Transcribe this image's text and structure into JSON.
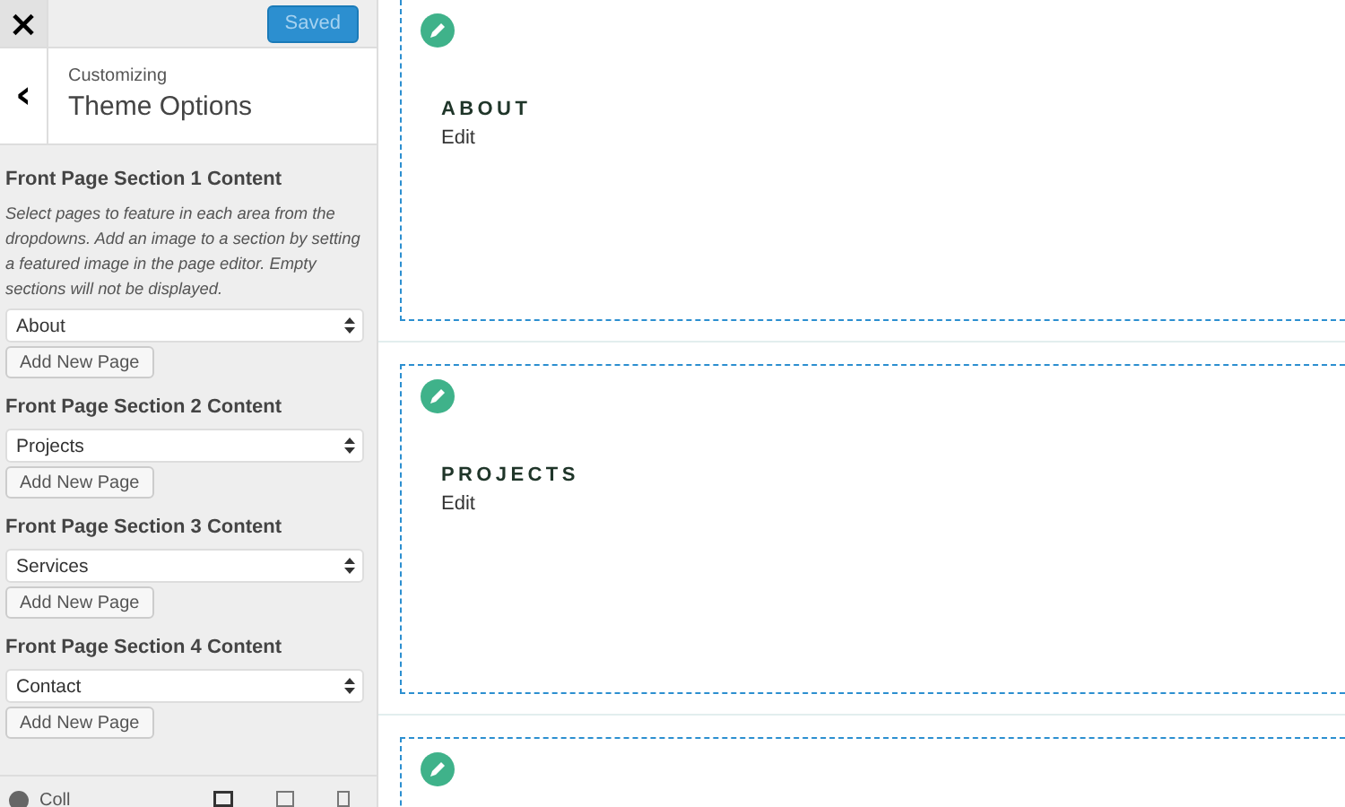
{
  "top_bar": {
    "close": "×",
    "save_button": {
      "label": "Saved",
      "disabled": true
    }
  },
  "header": {
    "back": "‹",
    "subtitle": "Customizing",
    "title": "Theme Options"
  },
  "sections": [
    {
      "heading": "Front Page Section 1 Content",
      "description": "Select pages to feature in each area from the dropdowns. Add an image to a section by setting a featured image in the page editor. Empty sections will not be displayed.",
      "value": "About",
      "button": "Add New Page"
    },
    {
      "heading": "Front Page Section 2 Content",
      "value": "Projects",
      "button": "Add New Page"
    },
    {
      "heading": "Front Page Section 3 Content",
      "value": "Services",
      "button": "Add New Page"
    },
    {
      "heading": "Front Page Section 4 Content",
      "value": "Contact",
      "button": "Add New Page"
    }
  ],
  "footer": {
    "collapse": "Coll"
  },
  "preview": [
    {
      "kind": "section",
      "title": "ABOUT",
      "link": "Edit"
    },
    {
      "kind": "section",
      "title": "PROJECTS",
      "link": "Edit"
    },
    {
      "kind": "cut_off"
    }
  ]
}
